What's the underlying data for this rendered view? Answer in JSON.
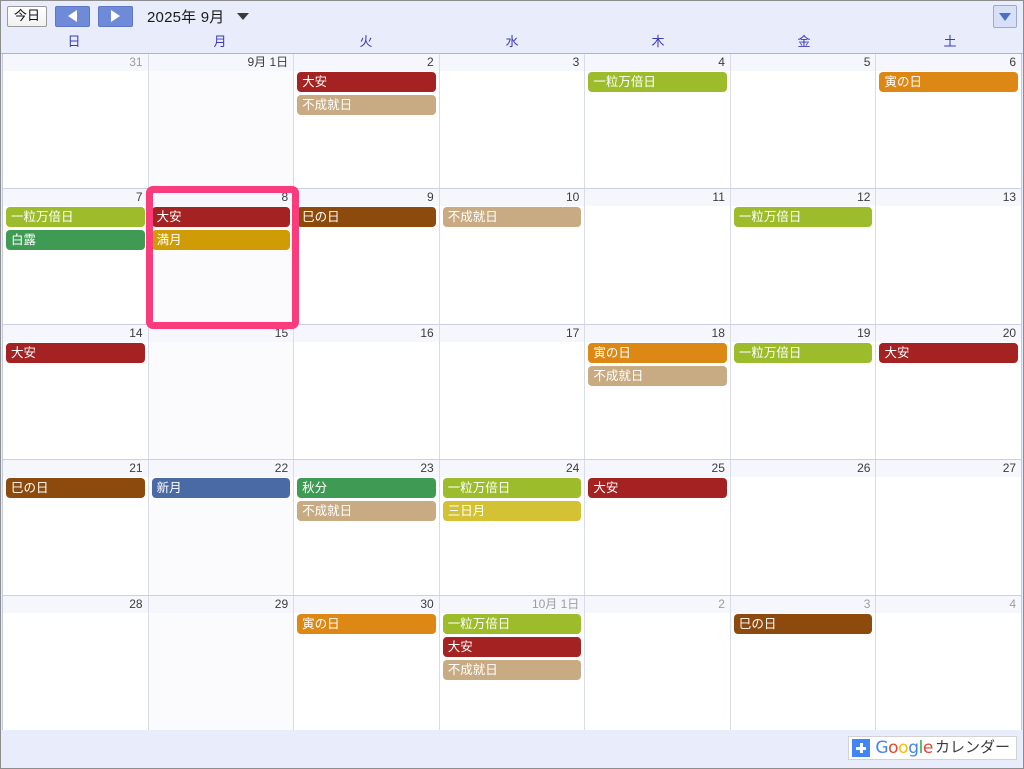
{
  "toolbar": {
    "today_label": "今日",
    "prev_label": "前",
    "next_label": "次",
    "title": "2025年 9月",
    "dropdown_icon": "chevron-down-icon",
    "filter_icon": "filter-dropdown-icon"
  },
  "weekdays": [
    "日",
    "月",
    "火",
    "水",
    "木",
    "金",
    "土"
  ],
  "event_colors": {
    "大安": "#a52222",
    "不成就日": "#c8ab83",
    "一粒万倍日": "#9dbc2c",
    "寅の日": "#dd8815",
    "巳の日": "#8d4a0d",
    "白露": "#3f9b54",
    "秋分": "#3f9b54",
    "満月": "#cf9c06",
    "三日月": "#d4c235",
    "新月": "#4a6aa5"
  },
  "weeks": [
    {
      "days": [
        {
          "date": "31",
          "other_month": true,
          "events": []
        },
        {
          "date": "9月 1日",
          "other_month": false,
          "events": []
        },
        {
          "date": "2",
          "other_month": false,
          "events": [
            "大安",
            "不成就日"
          ]
        },
        {
          "date": "3",
          "other_month": false,
          "events": []
        },
        {
          "date": "4",
          "other_month": false,
          "events": [
            "一粒万倍日"
          ]
        },
        {
          "date": "5",
          "other_month": false,
          "events": []
        },
        {
          "date": "6",
          "other_month": false,
          "events": [
            "寅の日"
          ]
        }
      ]
    },
    {
      "days": [
        {
          "date": "7",
          "other_month": false,
          "events": [
            "一粒万倍日",
            "白露"
          ]
        },
        {
          "date": "8",
          "other_month": false,
          "events": [
            "大安",
            "満月"
          ],
          "highlighted": true
        },
        {
          "date": "9",
          "other_month": false,
          "events": [
            "巳の日"
          ]
        },
        {
          "date": "10",
          "other_month": false,
          "events": [
            "不成就日"
          ]
        },
        {
          "date": "11",
          "other_month": false,
          "events": []
        },
        {
          "date": "12",
          "other_month": false,
          "events": [
            "一粒万倍日"
          ]
        },
        {
          "date": "13",
          "other_month": false,
          "events": []
        }
      ]
    },
    {
      "days": [
        {
          "date": "14",
          "other_month": false,
          "events": [
            "大安"
          ]
        },
        {
          "date": "15",
          "other_month": false,
          "events": []
        },
        {
          "date": "16",
          "other_month": false,
          "events": []
        },
        {
          "date": "17",
          "other_month": false,
          "events": []
        },
        {
          "date": "18",
          "other_month": false,
          "events": [
            "寅の日",
            "不成就日"
          ]
        },
        {
          "date": "19",
          "other_month": false,
          "events": [
            "一粒万倍日"
          ]
        },
        {
          "date": "20",
          "other_month": false,
          "events": [
            "大安"
          ]
        }
      ]
    },
    {
      "days": [
        {
          "date": "21",
          "other_month": false,
          "events": [
            "巳の日"
          ]
        },
        {
          "date": "22",
          "other_month": false,
          "events": [
            "新月"
          ]
        },
        {
          "date": "23",
          "other_month": false,
          "events": [
            "秋分",
            "不成就日"
          ]
        },
        {
          "date": "24",
          "other_month": false,
          "events": [
            "一粒万倍日",
            "三日月"
          ]
        },
        {
          "date": "25",
          "other_month": false,
          "events": [
            "大安"
          ]
        },
        {
          "date": "26",
          "other_month": false,
          "events": []
        },
        {
          "date": "27",
          "other_month": false,
          "events": []
        }
      ]
    },
    {
      "days": [
        {
          "date": "28",
          "other_month": false,
          "events": []
        },
        {
          "date": "29",
          "other_month": false,
          "events": []
        },
        {
          "date": "30",
          "other_month": false,
          "events": [
            "寅の日"
          ]
        },
        {
          "date": "10月 1日",
          "other_month": true,
          "events": [
            "一粒万倍日",
            "大安",
            "不成就日"
          ]
        },
        {
          "date": "2",
          "other_month": true,
          "events": []
        },
        {
          "date": "3",
          "other_month": true,
          "events": [
            "巳の日"
          ]
        },
        {
          "date": "4",
          "other_month": true,
          "events": []
        }
      ]
    }
  ],
  "footer": {
    "plus_icon": "plus-icon",
    "google_letters": [
      {
        "ch": "G",
        "color": "#4285f4"
      },
      {
        "ch": "o",
        "color": "#ea4335"
      },
      {
        "ch": "o",
        "color": "#fbbc05"
      },
      {
        "ch": "g",
        "color": "#4285f4"
      },
      {
        "ch": "l",
        "color": "#34a853"
      },
      {
        "ch": "e",
        "color": "#ea4335"
      }
    ],
    "suffix": "カレンダー"
  },
  "highlight": {
    "color": "#fb3c7c"
  }
}
